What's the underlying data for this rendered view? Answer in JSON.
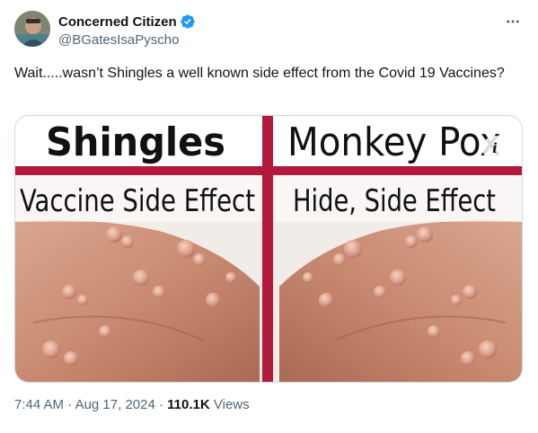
{
  "author": {
    "display_name": "Concerned Citizen",
    "handle": "@BGatesIsaPyscho",
    "verified_color": "#1d9bf0"
  },
  "tweet": {
    "text": "Wait.....wasn’t Shingles a well known side effect from the Covid 19 Vaccines?"
  },
  "media": {
    "left_title": "Shingles",
    "left_caption": "Vaccine Side Effect",
    "right_title": "Monkey Pox",
    "right_caption": "Hide, Side Effect",
    "divider_color": "#b3193a",
    "info_label": "i"
  },
  "meta": {
    "time": "7:44 AM",
    "separator": "·",
    "date": "Aug 17, 2024",
    "views_count": "110.1K",
    "views_label": "Views"
  },
  "icons": {
    "more": "more-horizontal-icon",
    "verified": "verified-badge-icon"
  }
}
